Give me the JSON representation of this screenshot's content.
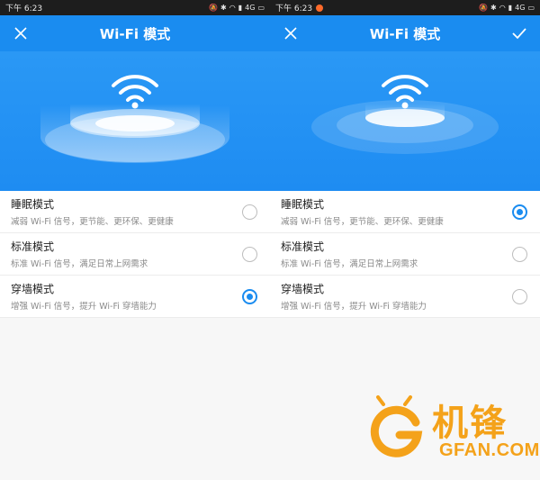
{
  "screens": [
    {
      "status": {
        "time": "下午 6:23",
        "network": "4G"
      },
      "appbar": {
        "title": "Wi-Fi 模式",
        "left_icon": "close-icon",
        "right_icon": ""
      },
      "options": [
        {
          "title": "睡眠模式",
          "desc": "减弱 Wi-Fi 信号，更节能、更环保、更健康",
          "selected": false
        },
        {
          "title": "标准模式",
          "desc": "标准 Wi-Fi 信号，满足日常上网需求",
          "selected": false
        },
        {
          "title": "穿墙模式",
          "desc": "增强 Wi-Fi 信号，提升 Wi-Fi 穿墙能力",
          "selected": true
        }
      ]
    },
    {
      "status": {
        "time": "下午 6:23",
        "network": "4G"
      },
      "appbar": {
        "title": "Wi-Fi 模式",
        "left_icon": "close-icon",
        "right_icon": "checkmark-icon"
      },
      "options": [
        {
          "title": "睡眠模式",
          "desc": "减弱 Wi-Fi 信号，更节能、更环保、更健康",
          "selected": true
        },
        {
          "title": "标准模式",
          "desc": "标准 Wi-Fi 信号，满足日常上网需求",
          "selected": false
        },
        {
          "title": "穿墙模式",
          "desc": "增强 Wi-Fi 信号，提升 Wi-Fi 穿墙能力",
          "selected": false
        }
      ]
    }
  ],
  "watermark": {
    "cn": "机锋",
    "en": "GFAN.COM"
  },
  "colors": {
    "accent": "#1a8cf0",
    "watermark": "#f4a21a"
  }
}
